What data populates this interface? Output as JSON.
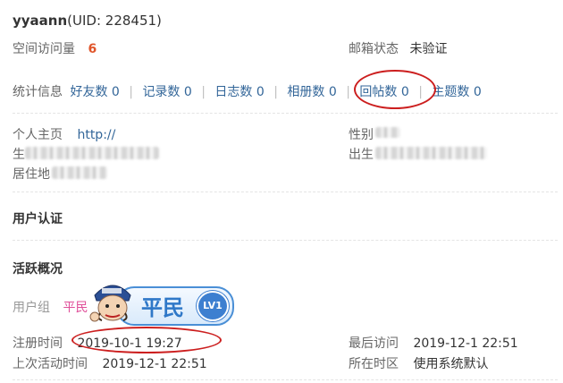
{
  "profile": {
    "username": "yyaann",
    "uid_text": "(UID: 228451)"
  },
  "overview": {
    "visits_label": "空间访问量",
    "visits_value": "6",
    "email_label": "邮箱状态",
    "email_value": "未验证"
  },
  "stats": {
    "label": "统计信息",
    "items": [
      {
        "label": "好友数 0"
      },
      {
        "label": "记录数 0"
      },
      {
        "label": "日志数 0"
      },
      {
        "label": "相册数 0"
      },
      {
        "label": "回帖数 0"
      },
      {
        "label": "主题数 0"
      }
    ],
    "separator": "|"
  },
  "personal": {
    "homepage_label": "个人主页",
    "homepage_value": "http://",
    "gender_label_partial": "性别",
    "birthday_label_partial": "生",
    "birthplace_label_partial": "出生",
    "residence_label_partial": "居住地"
  },
  "sections": {
    "verification": "用户认证",
    "activity": "活跃概况"
  },
  "activity": {
    "group_label": "用户组",
    "group_value": "平民",
    "badge_text": "平民",
    "badge_level": "LV1",
    "register_label": "注册时间",
    "register_value": "2019-10-1 19:27",
    "last_visit_label": "最后访问",
    "last_visit_value": "2019-12-1 22:51",
    "last_active_label": "上次活动时间",
    "last_active_value": "2019-12-1 22:51",
    "timezone_label": "所在时区",
    "timezone_value": "使用系统默认"
  },
  "colors": {
    "accent_red": "#cc1f1f",
    "link_blue": "#336699",
    "group_pink": "#e0509a"
  }
}
